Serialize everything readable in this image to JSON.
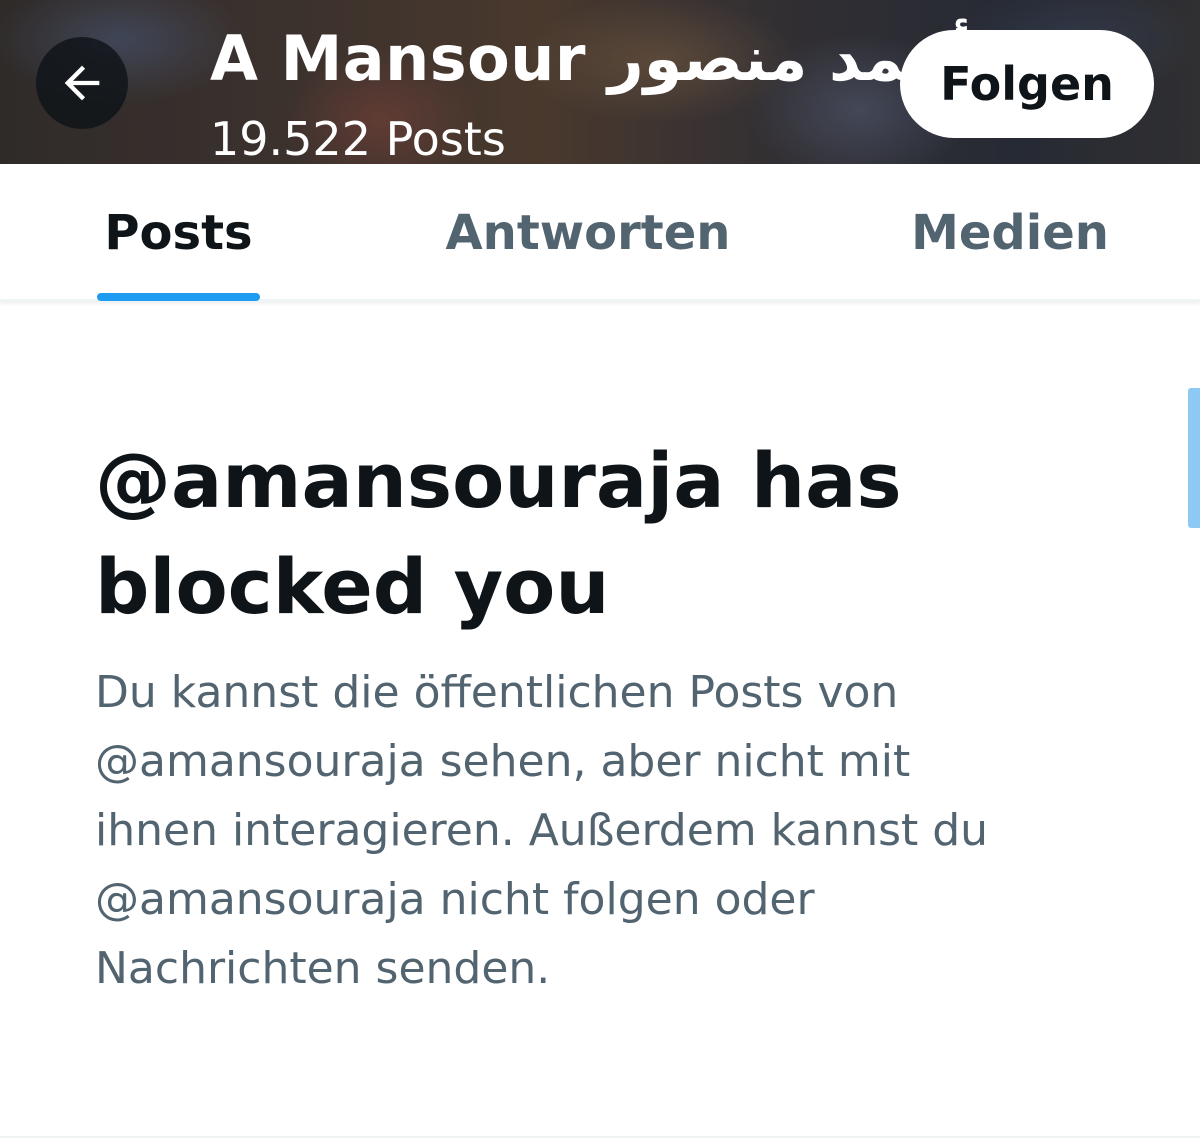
{
  "header": {
    "profile_name": "A Mansour أحمد منصور",
    "post_count": "19.522 Posts",
    "follow_label": "Folgen"
  },
  "tabs": [
    {
      "label": "Posts",
      "active": true
    },
    {
      "label": "Antworten",
      "active": false
    },
    {
      "label": "Medien",
      "active": false
    }
  ],
  "blocked": {
    "title": "@amansouraja has blocked you",
    "description": "Du kannst die öffentlichen Posts von @amansouraja sehen, aber nicht mit ihnen interagieren. Außerdem kannst du @amansouraja nicht folgen oder Nachrichten senden."
  },
  "colors": {
    "accent": "#1d9bf0",
    "text_primary": "#0f1419",
    "text_secondary": "#536471"
  },
  "icons": {
    "back": "arrow-left-icon"
  }
}
